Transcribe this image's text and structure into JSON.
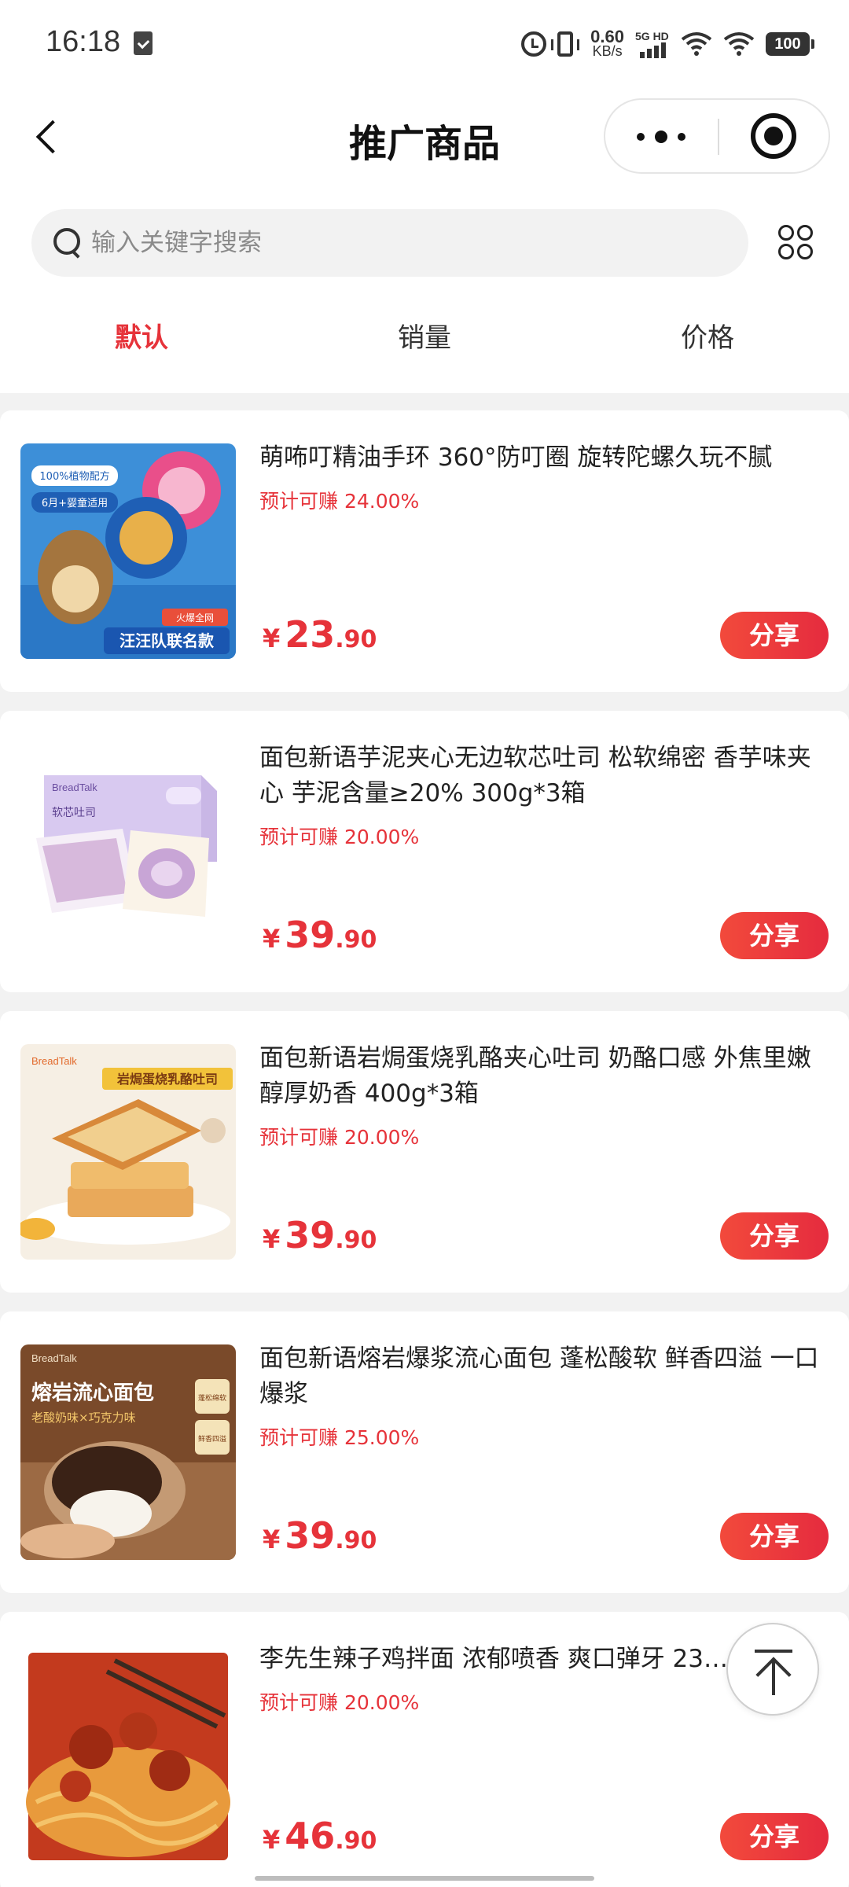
{
  "status_bar": {
    "time": "16:18",
    "net_speed_value": "0.60",
    "net_speed_unit": "KB/s",
    "network_type": "5G HD",
    "battery": "100"
  },
  "header": {
    "title": "推广商品"
  },
  "search": {
    "placeholder": "输入关键字搜索"
  },
  "sort_tabs": [
    {
      "label": "默认",
      "active": true
    },
    {
      "label": "销量",
      "active": false
    },
    {
      "label": "价格",
      "active": false
    }
  ],
  "products": [
    {
      "title": "萌咘叮精油手环 360°防叮圈 旋转陀螺久玩不腻",
      "commission_label": "预计可赚",
      "commission_pct": "24.00%",
      "currency": "¥",
      "price_int": "23",
      "price_dec": ".90",
      "share_label": "分享",
      "image_texts": [
        "100%植物配方",
        "6月+婴童适用",
        "火爆全网",
        "汪汪队联名款"
      ]
    },
    {
      "title": "面包新语芋泥夹心无边软芯吐司 松软绵密 香芋味夹心 芋泥含量≥20% 300g*3箱",
      "commission_label": "预计可赚",
      "commission_pct": "20.00%",
      "currency": "¥",
      "price_int": "39",
      "price_dec": ".90",
      "share_label": "分享",
      "image_texts": [
        "BreadTalk",
        "软芯吐司"
      ]
    },
    {
      "title": "面包新语岩焗蛋烧乳酪夹心吐司 奶酪口感 外焦里嫩 醇厚奶香 400g*3箱",
      "commission_label": "预计可赚",
      "commission_pct": "20.00%",
      "currency": "¥",
      "price_int": "39",
      "price_dec": ".90",
      "share_label": "分享",
      "image_texts": [
        "BreadTalk",
        "岩焗蛋烧乳酪吐司"
      ]
    },
    {
      "title": "面包新语熔岩爆浆流心面包 蓬松酸软 鲜香四溢 一口爆浆",
      "commission_label": "预计可赚",
      "commission_pct": "25.00%",
      "currency": "¥",
      "price_int": "39",
      "price_dec": ".90",
      "share_label": "分享",
      "image_texts": [
        "BreadTalk",
        "熔岩流心面包",
        "老酸奶味×巧克力味",
        "蓬松绵软",
        "鲜香四溢"
      ]
    },
    {
      "title": "李先生辣子鸡拌面 浓郁喷香 爽口弹牙 23…",
      "commission_label": "预计可赚",
      "commission_pct": "20.00%",
      "currency": "¥",
      "price_int": "46",
      "price_dec": ".90",
      "share_label": "分享",
      "image_texts": []
    }
  ],
  "colors": {
    "accent": "#e6333a",
    "background": "#f2f2f2",
    "card": "#ffffff"
  },
  "icons": {
    "back": "chevron-left-icon",
    "more": "more-dots-icon",
    "close": "target-close-icon",
    "search": "search-icon",
    "grid": "grid-icon",
    "back_to_top": "arrow-up-icon"
  }
}
